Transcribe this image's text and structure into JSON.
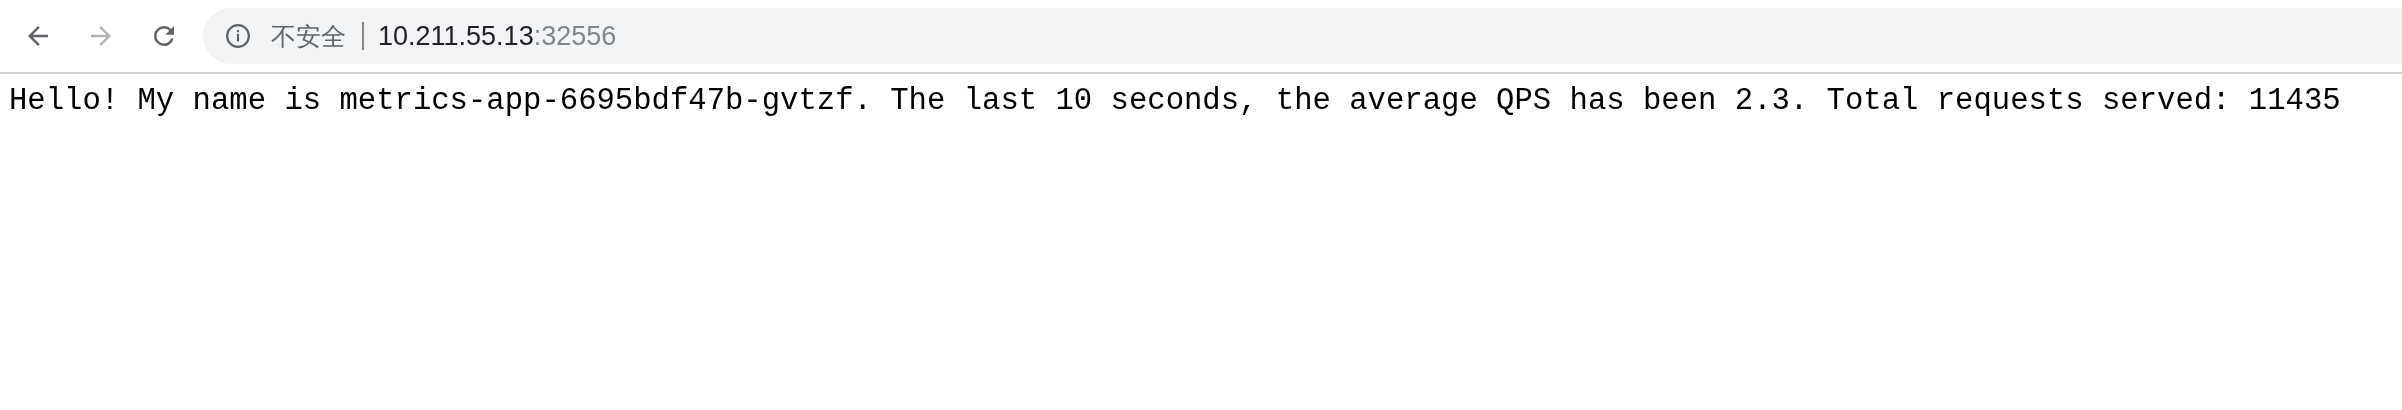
{
  "toolbar": {
    "back": {
      "disabled": false
    },
    "forward": {
      "disabled": true
    },
    "address_bar": {
      "security_label": "不安全",
      "host": "10.211.55.13",
      "port": ":32556"
    }
  },
  "page": {
    "text": "Hello! My name is metrics-app-6695bdf47b-gvtzf. The last 10 seconds, the average QPS has been 2.3. Total requests served: 11435"
  }
}
